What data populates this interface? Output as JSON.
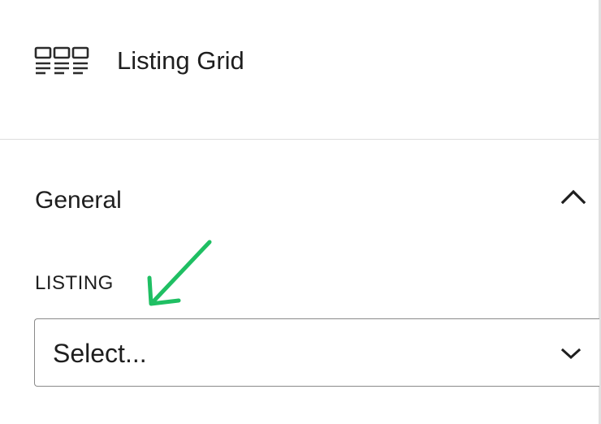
{
  "block": {
    "icon": "listing-grid-icon",
    "title": "Listing Grid"
  },
  "section": {
    "title": "General",
    "toggle_icon": "chevron-up-icon"
  },
  "field": {
    "label": "LISTING",
    "select": {
      "value": "Select...",
      "icon": "chevron-down-icon"
    }
  },
  "annotation": {
    "icon": "arrow-annotation",
    "color": "#1fbf63"
  }
}
